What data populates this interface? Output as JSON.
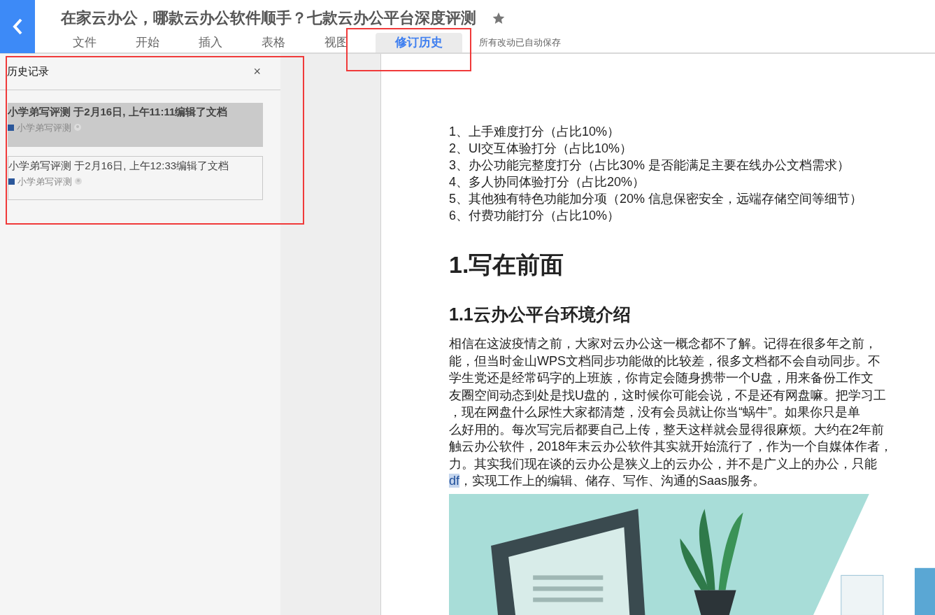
{
  "header": {
    "title": "在家云办公，哪款云办公软件顺手？七款云办公平台深度评测",
    "starred": true,
    "save_status": "所有改动已自动保存"
  },
  "tabs": [
    {
      "label": "文件",
      "selected": false
    },
    {
      "label": "开始",
      "selected": false
    },
    {
      "label": "插入",
      "selected": false
    },
    {
      "label": "表格",
      "selected": false
    },
    {
      "label": "视图",
      "selected": false
    },
    {
      "label": "修订历史",
      "selected": true
    }
  ],
  "history_panel": {
    "title": "历史记录",
    "close": "×",
    "entries": [
      {
        "summary": "小学弟写评测 于2月16日, 上午11:11编辑了文档",
        "author": "小学弟写评测",
        "color": "#2b579a",
        "selected": true
      },
      {
        "summary": "小学弟写评测 于2月16日, 上午12:33编辑了文档",
        "author": "小学弟写评测",
        "color": "#2b579a",
        "selected": false
      }
    ]
  },
  "document": {
    "criteria": [
      "1、上手难度打分（占比10%）",
      "2、UI交互体验打分（占比10%）",
      "3、办公功能完整度打分（占比30%  是否能满足主要在线办公文档需求）",
      "4、多人协同体验打分（占比20%）",
      "5、其他独有特色功能加分项（20% 信息保密安全，远端存储空间等细节）",
      "6、付费功能打分（占比10%）"
    ],
    "heading_1": "1.写在前面",
    "heading_2": "1.1云办公平台环境介绍",
    "paragraph_lines": [
      "相信在这波疫情之前，大家对云办公这一概念都不了解。记得在很多年之前，",
      "能，但当时金山WPS文档同步功能做的比较差，很多文档都不会自动同步。不",
      "学生党还是经常码字的上班族，你肯定会随身携带一个U盘，用来备份工作文",
      "友圈空间动态到处是找U盘的，这时候你可能会说，不是还有网盘嘛。把学习工",
      "，现在网盘什么尿性大家都清楚，没有会员就让你当“蜗牛”。如果你只是单",
      "么好用的。每次写完后都要自己上传，整天这样就会显得很麻烦。大约在2年前",
      "触云办公软件，2018年末云办公软件其实就开始流行了，作为一个自媒体作者，",
      "力。其实我们现在谈的云办公是狭义上的云办公，并不是广义上的办公，只能"
    ],
    "last_line": {
      "selected_text": "df",
      "rest": "，实现工作上的编辑、储存、写作、沟通的Saas服务。"
    }
  }
}
